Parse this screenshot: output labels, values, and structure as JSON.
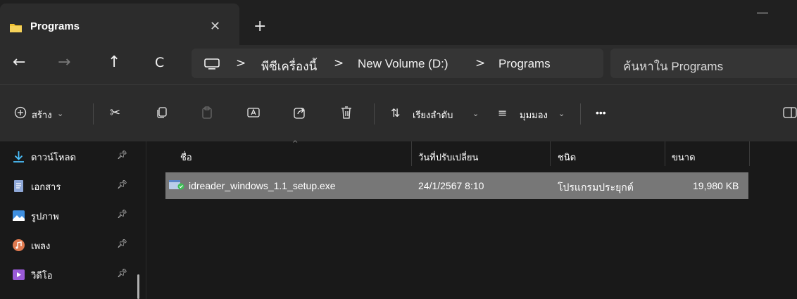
{
  "window": {
    "tab_title": "Programs",
    "tab_close": "✕",
    "new_tab": "+"
  },
  "nav": {
    "back": "←",
    "forward": "→",
    "up": "↑",
    "refresh": "C",
    "breadcrumb": [
      "พีซีเครื่องนี้",
      "New Volume (D:)",
      "Programs"
    ],
    "separator": ">",
    "search_placeholder": "ค้นหาใน Programs"
  },
  "toolbar": {
    "new_label": "สร้าง",
    "sort_label": "เรียงลำดับ",
    "view_label": "มุมมอง",
    "more": "•••"
  },
  "sidebar": {
    "items": [
      {
        "label": "ดาวน์โหลด",
        "icon": "download-icon",
        "color": "#4cc2ff"
      },
      {
        "label": "เอกสาร",
        "icon": "document-icon",
        "color": "#8fa8d8"
      },
      {
        "label": "รูปภาพ",
        "icon": "pictures-icon",
        "color": "#3f8fe0"
      },
      {
        "label": "เพลง",
        "icon": "music-icon",
        "color": "#e07a50"
      },
      {
        "label": "วิดีโอ",
        "icon": "video-icon",
        "color": "#9a5ad8"
      }
    ]
  },
  "columns": {
    "name": "ชื่อ",
    "date": "วันที่ปรับเปลี่ยน",
    "type": "ชนิด",
    "size": "ขนาด"
  },
  "files": [
    {
      "name": "idreader_windows_1.1_setup.exe",
      "date": "24/1/2567 8:10",
      "type": "โปรแกรมประยุกต์",
      "size": "19,980 KB"
    }
  ],
  "colors": {
    "folder": "#f1c232",
    "selection": "#777777",
    "accent": "#4cc2ff"
  }
}
